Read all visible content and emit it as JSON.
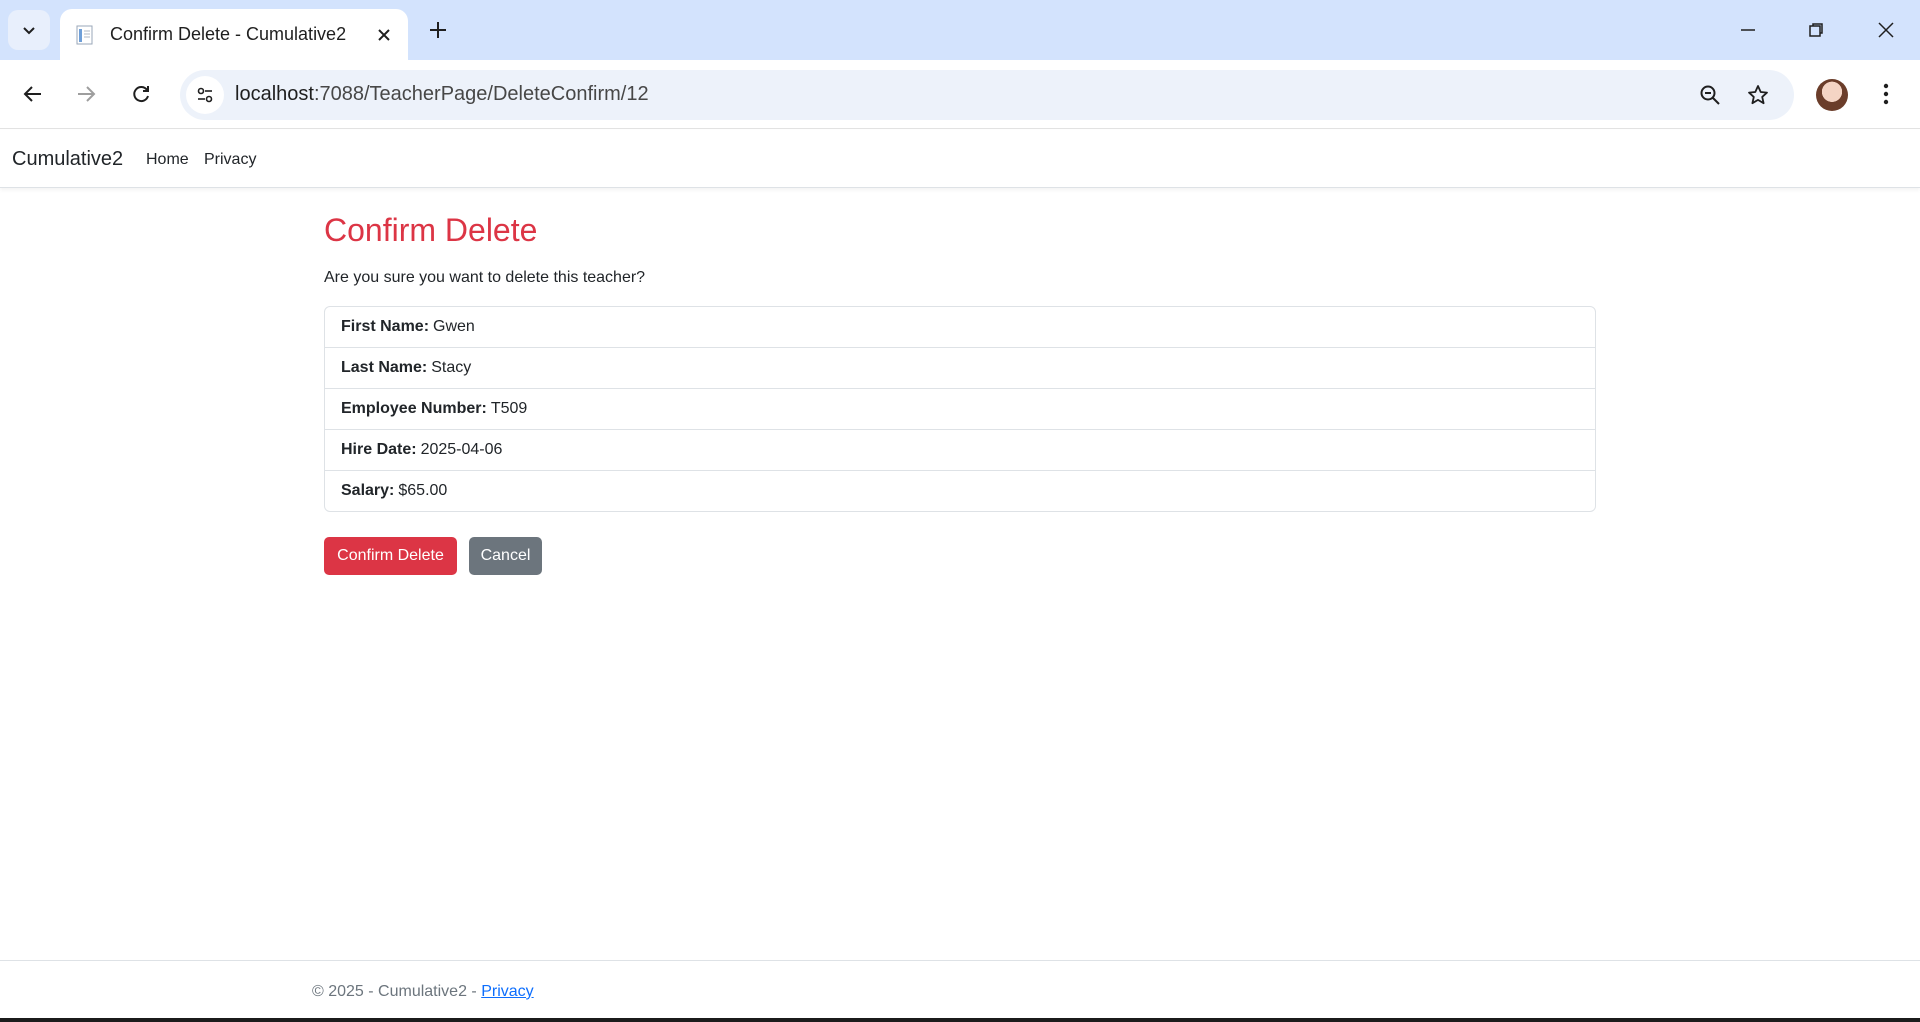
{
  "browser": {
    "tab_title": "Confirm Delete - Cumulative2",
    "url_host": "localhost",
    "url_path": ":7088/TeacherPage/DeleteConfirm/12"
  },
  "navbar": {
    "brand": "Cumulative2",
    "links": [
      "Home",
      "Privacy"
    ]
  },
  "main": {
    "title": "Confirm Delete",
    "question": "Are you sure you want to delete this teacher?",
    "details": [
      {
        "label": "First Name:",
        "value": "Gwen"
      },
      {
        "label": "Last Name:",
        "value": "Stacy"
      },
      {
        "label": "Employee Number:",
        "value": "T509"
      },
      {
        "label": "Hire Date:",
        "value": "2025-04-06"
      },
      {
        "label": "Salary:",
        "value": "$65.00"
      }
    ],
    "confirm_label": "Confirm Delete",
    "cancel_label": "Cancel"
  },
  "footer": {
    "text": "© 2025 - Cumulative2 - ",
    "link": "Privacy"
  },
  "colors": {
    "danger": "#dc3545",
    "secondary": "#6c757d",
    "link": "#0d6efd",
    "tabstrip": "#d3e3fd"
  }
}
